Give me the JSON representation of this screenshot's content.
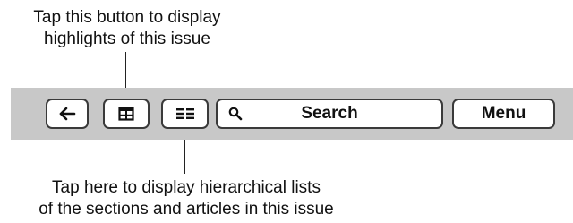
{
  "callouts": {
    "highlights": {
      "line1": "Tap this button to display",
      "line2": "highlights of this issue"
    },
    "contents": {
      "line1": "Tap here to display hierarchical lists",
      "line2": "of the sections and articles in this issue"
    }
  },
  "toolbar": {
    "background_color": "#c8c8c8",
    "back_icon": "left-arrow-icon",
    "highlights_icon": "grid-icon",
    "contents_icon": "list-icon",
    "search_icon": "magnifier-icon",
    "search_label": "Search",
    "menu_label": "Menu"
  }
}
